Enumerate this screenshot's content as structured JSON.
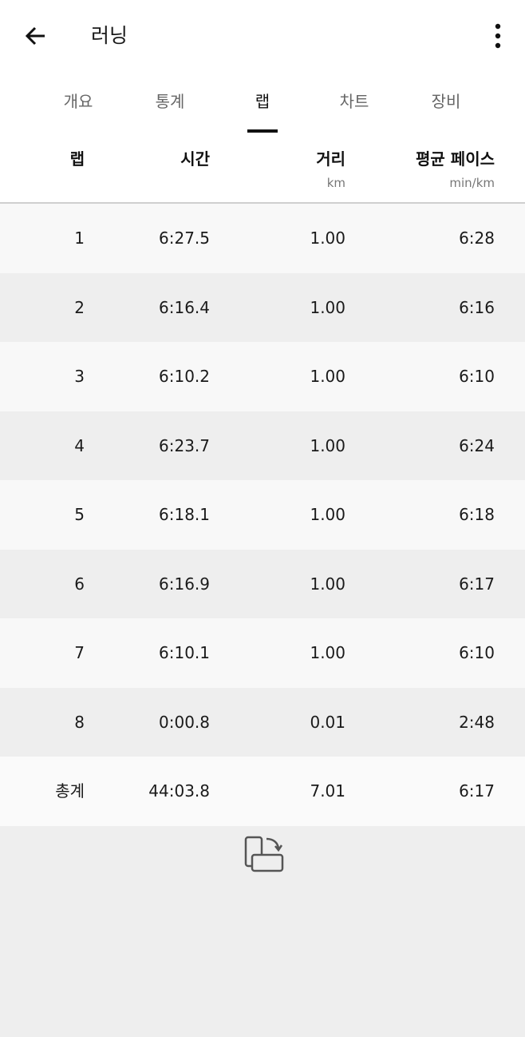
{
  "app": {
    "title": "러닝"
  },
  "icons": {
    "back": "arrow-left-icon",
    "more": "more-vertical-icon",
    "rotate": "rotate-screen-icon"
  },
  "tabs": [
    {
      "label": "개요",
      "active": false
    },
    {
      "label": "통계",
      "active": false
    },
    {
      "label": "랩",
      "active": true
    },
    {
      "label": "차트",
      "active": false
    },
    {
      "label": "장비",
      "active": false
    }
  ],
  "table": {
    "headers": {
      "lap": "랩",
      "time": "시간",
      "distance": "거리",
      "distance_unit": "km",
      "pace": "평균 페이스",
      "pace_unit": "min/km"
    },
    "rows": [
      {
        "lap": "1",
        "time": "6:27.5",
        "distance": "1.00",
        "pace": "6:28"
      },
      {
        "lap": "2",
        "time": "6:16.4",
        "distance": "1.00",
        "pace": "6:16"
      },
      {
        "lap": "3",
        "time": "6:10.2",
        "distance": "1.00",
        "pace": "6:10"
      },
      {
        "lap": "4",
        "time": "6:23.7",
        "distance": "1.00",
        "pace": "6:24"
      },
      {
        "lap": "5",
        "time": "6:18.1",
        "distance": "1.00",
        "pace": "6:18"
      },
      {
        "lap": "6",
        "time": "6:16.9",
        "distance": "1.00",
        "pace": "6:17"
      },
      {
        "lap": "7",
        "time": "6:10.1",
        "distance": "1.00",
        "pace": "6:10"
      },
      {
        "lap": "8",
        "time": "0:00.8",
        "distance": "0.01",
        "pace": "2:48"
      }
    ],
    "total": {
      "lap": "총계",
      "time": "44:03.8",
      "distance": "7.01",
      "pace": "6:17"
    }
  }
}
